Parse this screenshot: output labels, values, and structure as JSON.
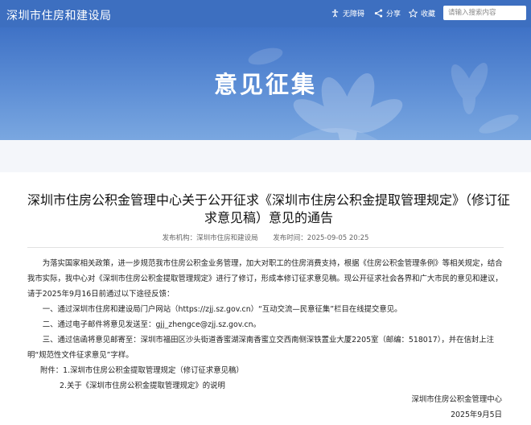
{
  "header": {
    "site_name": "深圳市住房和建设局",
    "tools": [
      {
        "label": "无障碍",
        "icon": "accessibility-icon"
      },
      {
        "label": "分享",
        "icon": "share-icon"
      },
      {
        "label": "收藏",
        "icon": "star-icon"
      }
    ],
    "search_placeholder": "请输入搜索内容"
  },
  "banner": {
    "title": "意见征集"
  },
  "article": {
    "title": "深圳市住房公积金管理中心关于公开征求《深圳市住房公积金提取管理规定》（修订征求意见稿）意见的通告",
    "source_label": "发布机构：深圳市住房和建设局",
    "date_label": "发布时间：2025-09-05 20:25",
    "intro": "为落实国家相关政策，进一步规范我市住房公积金业务管理，加大对职工的住房消费支持，根据《住房公积金管理条例》等相关规定，结合我市实际，我中心对《深圳市住房公积金提取管理规定》进行了修订，形成本修订征求意见稿。现公开征求社会各界和广大市民的意见和建议，请于2025年9月16日前通过以下途径反馈：",
    "item1": "一、通过深圳市住房和建设局门户网站（https://zjj.sz.gov.cn）“互动交流—民意征集”栏目在线提交意见。",
    "item2_prefix": "二、通过电子邮件将意见发送至：",
    "item2_email": "gjj_zhengce@zjj.sz.gov.cn",
    "item2_suffix": "。",
    "item3": "三、通过信函将意见邮寄至：深圳市福田区沙头街道香蜜湖深南香蜜立交西南侧深铁置业大厦2205室（邮编：518017），并在信封上注明“规范性文件征求意见”字样。",
    "attachment1": "附件：1.深圳市住房公积金提取管理规定（修订征求意见稿）",
    "attachment2": "2.关于《深圳市住房公积金提取管理规定》的说明",
    "signature": "深圳市住房公积金管理中心",
    "sign_date": "2025年9月5日"
  }
}
